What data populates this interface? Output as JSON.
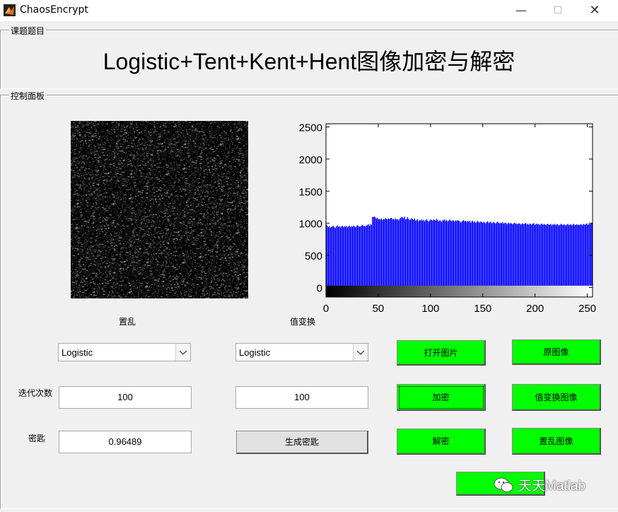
{
  "window": {
    "title": "ChaosEncrypt",
    "min_glyph": "—",
    "max_glyph": "☐",
    "close_glyph": "✕"
  },
  "header_group": {
    "legend": "课题题目",
    "title": "Logistic+Tent+Kent+Hent图像加密与解密"
  },
  "control_group": {
    "legend": "控制面板"
  },
  "labels": {
    "scramble": "置乱",
    "value_transform": "值变换",
    "iterations": "迭代次数",
    "key": "密匙"
  },
  "controls": {
    "scramble_map": "Logistic",
    "transform_map": "Logistic",
    "scramble_iterations": "100",
    "transform_iterations": "100",
    "key_value": "0.96489",
    "generate_key": "生成密匙"
  },
  "buttons": {
    "open_image": "打开图片",
    "original_image": "原图像",
    "encrypt": "加密",
    "value_transform_image": "值变换图像",
    "decrypt": "解密",
    "scramble_image": "置乱图像",
    "bottom": ""
  },
  "watermark": "天天Matlab",
  "colors": {
    "button_green": "#00ff00",
    "bar_blue": "#0000ff"
  },
  "chart_data": {
    "type": "bar",
    "title": "",
    "xlabel": "",
    "ylabel": "",
    "xlim": [
      0,
      255
    ],
    "ylim": [
      -150,
      2550
    ],
    "x_ticks": [
      0,
      50,
      100,
      150,
      200,
      250
    ],
    "y_ticks": [
      0,
      500,
      1000,
      1500,
      2000,
      2500
    ],
    "colorbar": "gray 0-255",
    "series": [
      {
        "values": [
          980,
          960,
          940,
          955,
          930,
          945,
          950,
          960,
          940,
          925,
          950,
          965,
          945,
          955,
          935,
          950,
          960,
          940,
          955,
          945,
          960,
          935,
          950,
          965,
          940,
          955,
          945,
          960,
          950,
          940,
          955,
          970,
          960,
          945,
          950,
          960,
          975,
          960,
          955,
          950,
          965,
          970,
          985,
          960,
          990,
          975,
          1100,
          1095,
          1105,
          1090,
          1070,
          1085,
          1060,
          1070,
          1055,
          1075,
          1050,
          1065,
          1060,
          1080,
          1070,
          1060,
          1075,
          1065,
          1080,
          1085,
          1060,
          1070,
          1055,
          1075,
          1060,
          1065,
          1045,
          1070,
          1080,
          1100,
          1090,
          1080,
          1105,
          1060,
          1070,
          1095,
          1070,
          1050,
          1060,
          1080,
          1065,
          1055,
          1075,
          1040,
          1050,
          1065,
          1030,
          1050,
          1045,
          1060,
          1040,
          1055,
          1030,
          1050,
          1060,
          1040,
          1025,
          1045,
          1060,
          1050,
          1040,
          1060,
          1050,
          1040,
          1070,
          1050,
          1030,
          1045,
          1040,
          1020,
          1050,
          1045,
          1060,
          1035,
          1050,
          1030,
          1040,
          1060,
          1045,
          1030,
          1050,
          1040,
          1025,
          1045,
          1035,
          1050,
          1040,
          1030,
          1010,
          1025,
          1040,
          1050,
          1030,
          1040,
          1020,
          1035,
          1025,
          1040,
          1010,
          1030,
          1040,
          1015,
          1030,
          1005,
          1025,
          1035,
          1020,
          1010,
          1030,
          1020,
          1005,
          1025,
          1010,
          1000,
          1020,
          1030,
          1005,
          1015,
          1025,
          1000,
          1010,
          1020,
          1005,
          995,
          1015,
          1025,
          1005,
          995,
          1010,
          1000,
          1015,
          995,
          1005,
          1010,
          985,
          1000,
          1010,
          990,
          1005,
          995,
          985,
          1000,
          1010,
          990,
          995,
          985,
          1000,
          995,
          980,
          990,
          1000,
          985,
          995,
          1005,
          980,
          990,
          975,
          995,
          985,
          980,
          995,
          1000,
          975,
          985,
          995,
          980,
          990,
          970,
          985,
          995,
          975,
          990,
          980,
          970,
          985,
          990,
          975,
          980,
          990,
          965,
          985,
          975,
          990,
          970,
          985,
          980,
          965,
          975,
          990,
          980,
          970,
          985,
          975,
          965,
          980,
          990,
          970,
          975,
          985,
          965,
          980,
          990,
          970,
          975,
          985,
          970,
          980,
          975,
          985,
          970,
          980,
          990,
          975,
          985,
          1000,
          975,
          990,
          985,
          995,
          1000
        ]
      }
    ]
  }
}
